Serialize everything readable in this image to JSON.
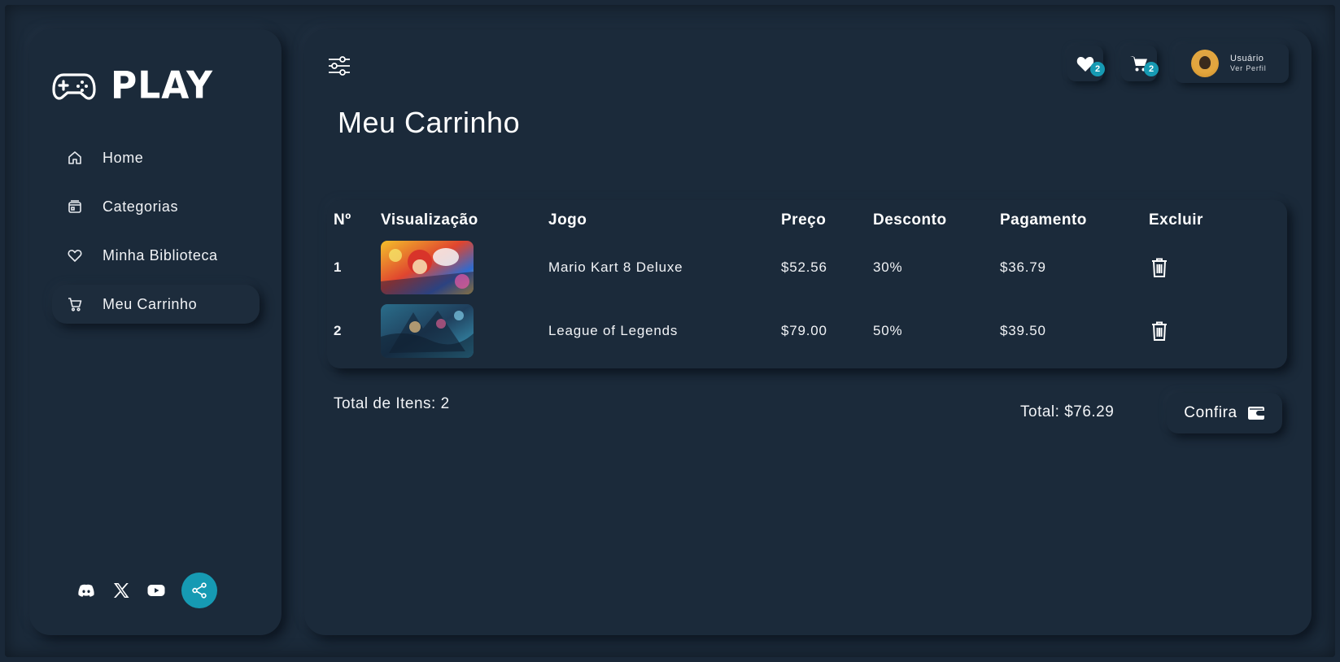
{
  "brand": {
    "name": "PLAY"
  },
  "sidebar": {
    "items": [
      {
        "label": "Home",
        "icon": "home-icon"
      },
      {
        "label": "Categorias",
        "icon": "categories-icon"
      },
      {
        "label": "Minha Biblioteca",
        "icon": "heart-icon"
      },
      {
        "label": "Meu Carrinho",
        "icon": "cart-icon",
        "active": true
      }
    ],
    "social": [
      "discord-icon",
      "x-icon",
      "youtube-icon",
      "share-icon"
    ]
  },
  "header": {
    "favorites_count": "2",
    "cart_count": "2",
    "user": {
      "name": "Usuário",
      "link": "Ver Perfil"
    }
  },
  "page": {
    "title": "Meu Carrinho"
  },
  "table": {
    "columns": [
      "Nº",
      "Visualização",
      "Jogo",
      "Preço",
      "Desconto",
      "Pagamento",
      "Excluir"
    ],
    "rows": [
      {
        "num": "1",
        "game": "Mario Kart 8 Deluxe",
        "price": "$52.56",
        "discount": "30%",
        "payment": "$36.79"
      },
      {
        "num": "2",
        "game": "League of Legends",
        "price": "$79.00",
        "discount": "50%",
        "payment": "$39.50"
      }
    ]
  },
  "summary": {
    "total_items": "Total de Itens: 2",
    "total": "Total: $76.29",
    "checkout_label": "Confira"
  },
  "colors": {
    "background": "#1b2a3a",
    "accent": "#169ab3",
    "text": "#ffffff"
  }
}
